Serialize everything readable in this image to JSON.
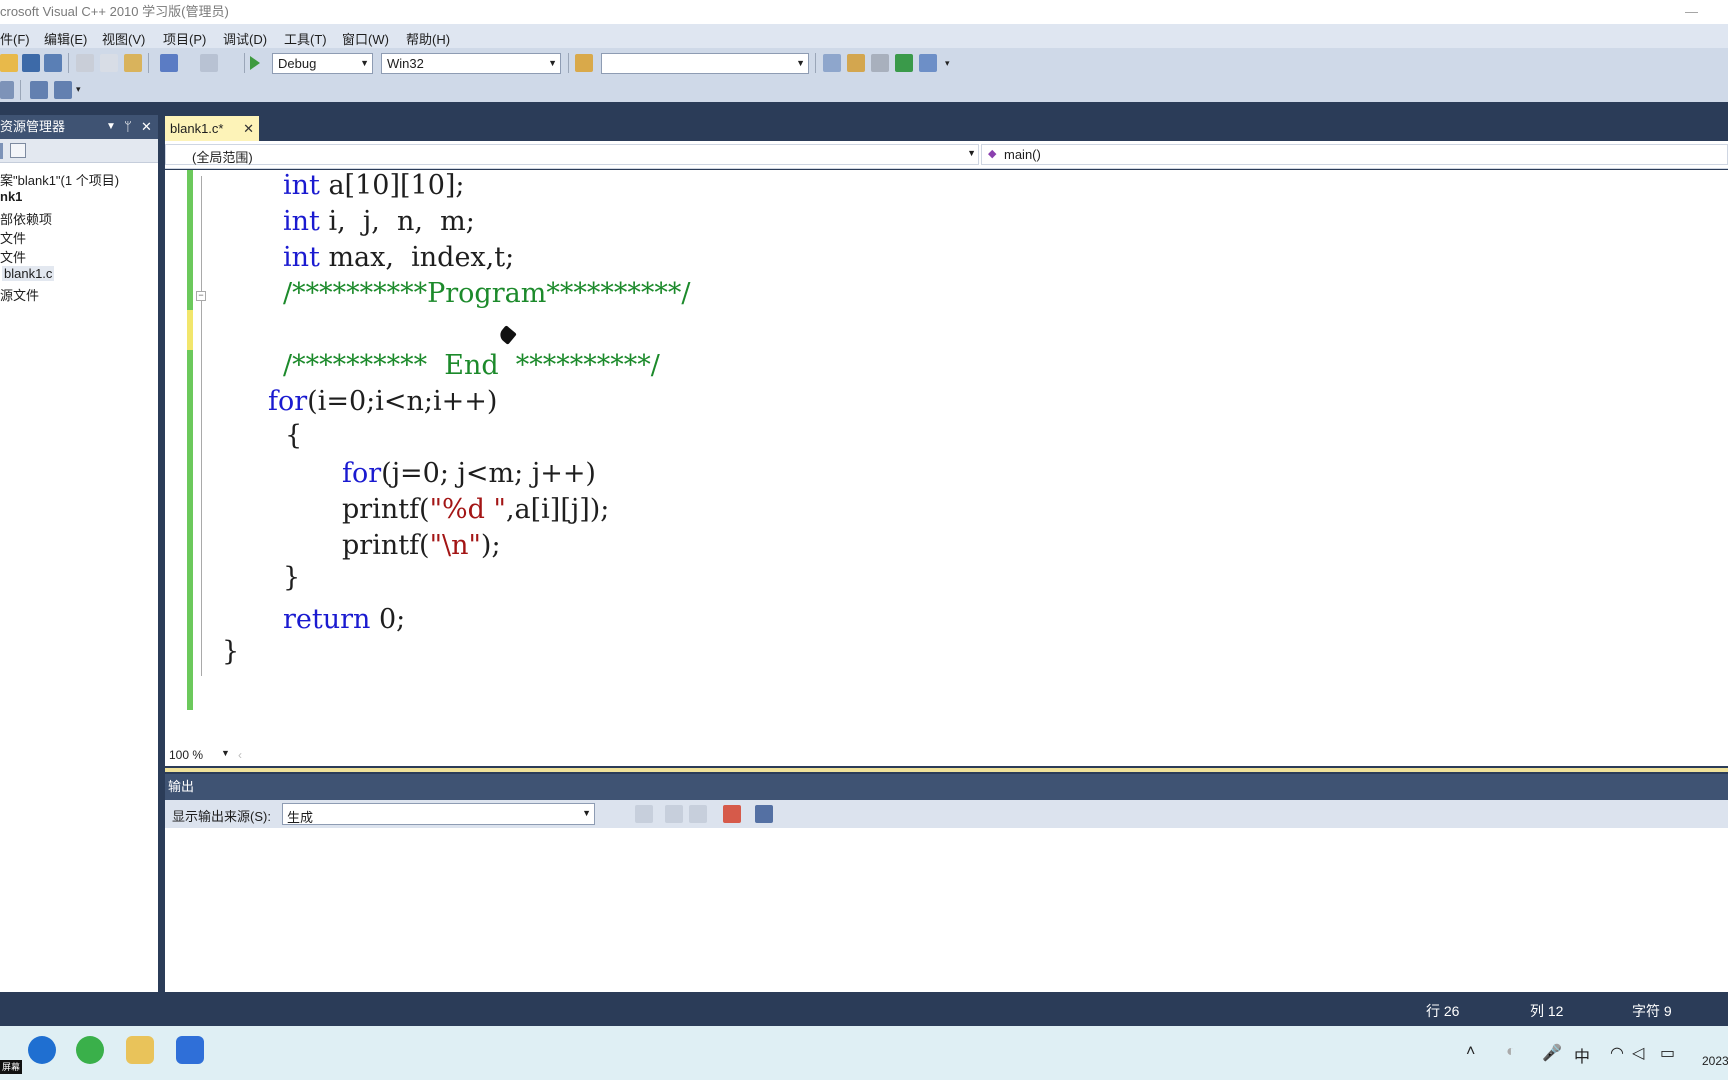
{
  "window": {
    "title": "crosoft Visual C++ 2010 学习版(管理员)",
    "min_glyph": "—"
  },
  "menu": [
    "件(F)",
    "编辑(E)",
    "视图(V)",
    "项目(P)",
    "调试(D)",
    "工具(T)",
    "窗口(W)",
    "帮助(H)"
  ],
  "toolbar": {
    "config": "Debug",
    "platform": "Win32",
    "find_value": ""
  },
  "solution_explorer": {
    "title": "资源管理器",
    "items": [
      "案\"blank1\"(1 个项目)",
      "nk1",
      "部依赖项",
      "文件",
      "文件",
      "blank1.c",
      "源文件"
    ]
  },
  "editor": {
    "tab_label": "blank1.c*",
    "scope": "(全局范围)",
    "function": "main()",
    "zoom": "100 %",
    "lines": {
      "l1_kw": "int",
      "l1_rest": " a[10][10];",
      "l2_kw": "int",
      "l2_rest": " i,  j,  n,  m;",
      "l3_kw": "int",
      "l3_rest": " max,  index,t;",
      "l4": "/**********Program**********/",
      "l5": "/**********  End  **********/",
      "l6_kw": "for",
      "l6_rest": "(i=0;i<n;i++)",
      "l7": "{",
      "l8_kw": "for",
      "l8_rest": "(j=0; j<m; j++)",
      "l9_a": "printf(",
      "l9_str": "\"%d \"",
      "l9_b": ",a[i][j]);",
      "l10_a": "printf(",
      "l10_str": "\"\\n\"",
      "l10_b": ");",
      "l11": "}",
      "l12_kw": "return",
      "l12_rest": " 0;",
      "l13": "}"
    }
  },
  "output": {
    "title": "输出",
    "source_label": "显示输出来源(S):",
    "source_value": "生成"
  },
  "status": {
    "line": "行 26",
    "col": "列 12",
    "char": "字符 9"
  },
  "taskbar": {
    "tray_ime": "中",
    "clock_partial": "2023",
    "corner_label": "屏幕"
  },
  "colors": {
    "frame": "#2b3c58",
    "keyword": "#1a1ad0",
    "comment": "#1c8a2b",
    "string": "#a31515",
    "tab": "#fdf3b8"
  }
}
